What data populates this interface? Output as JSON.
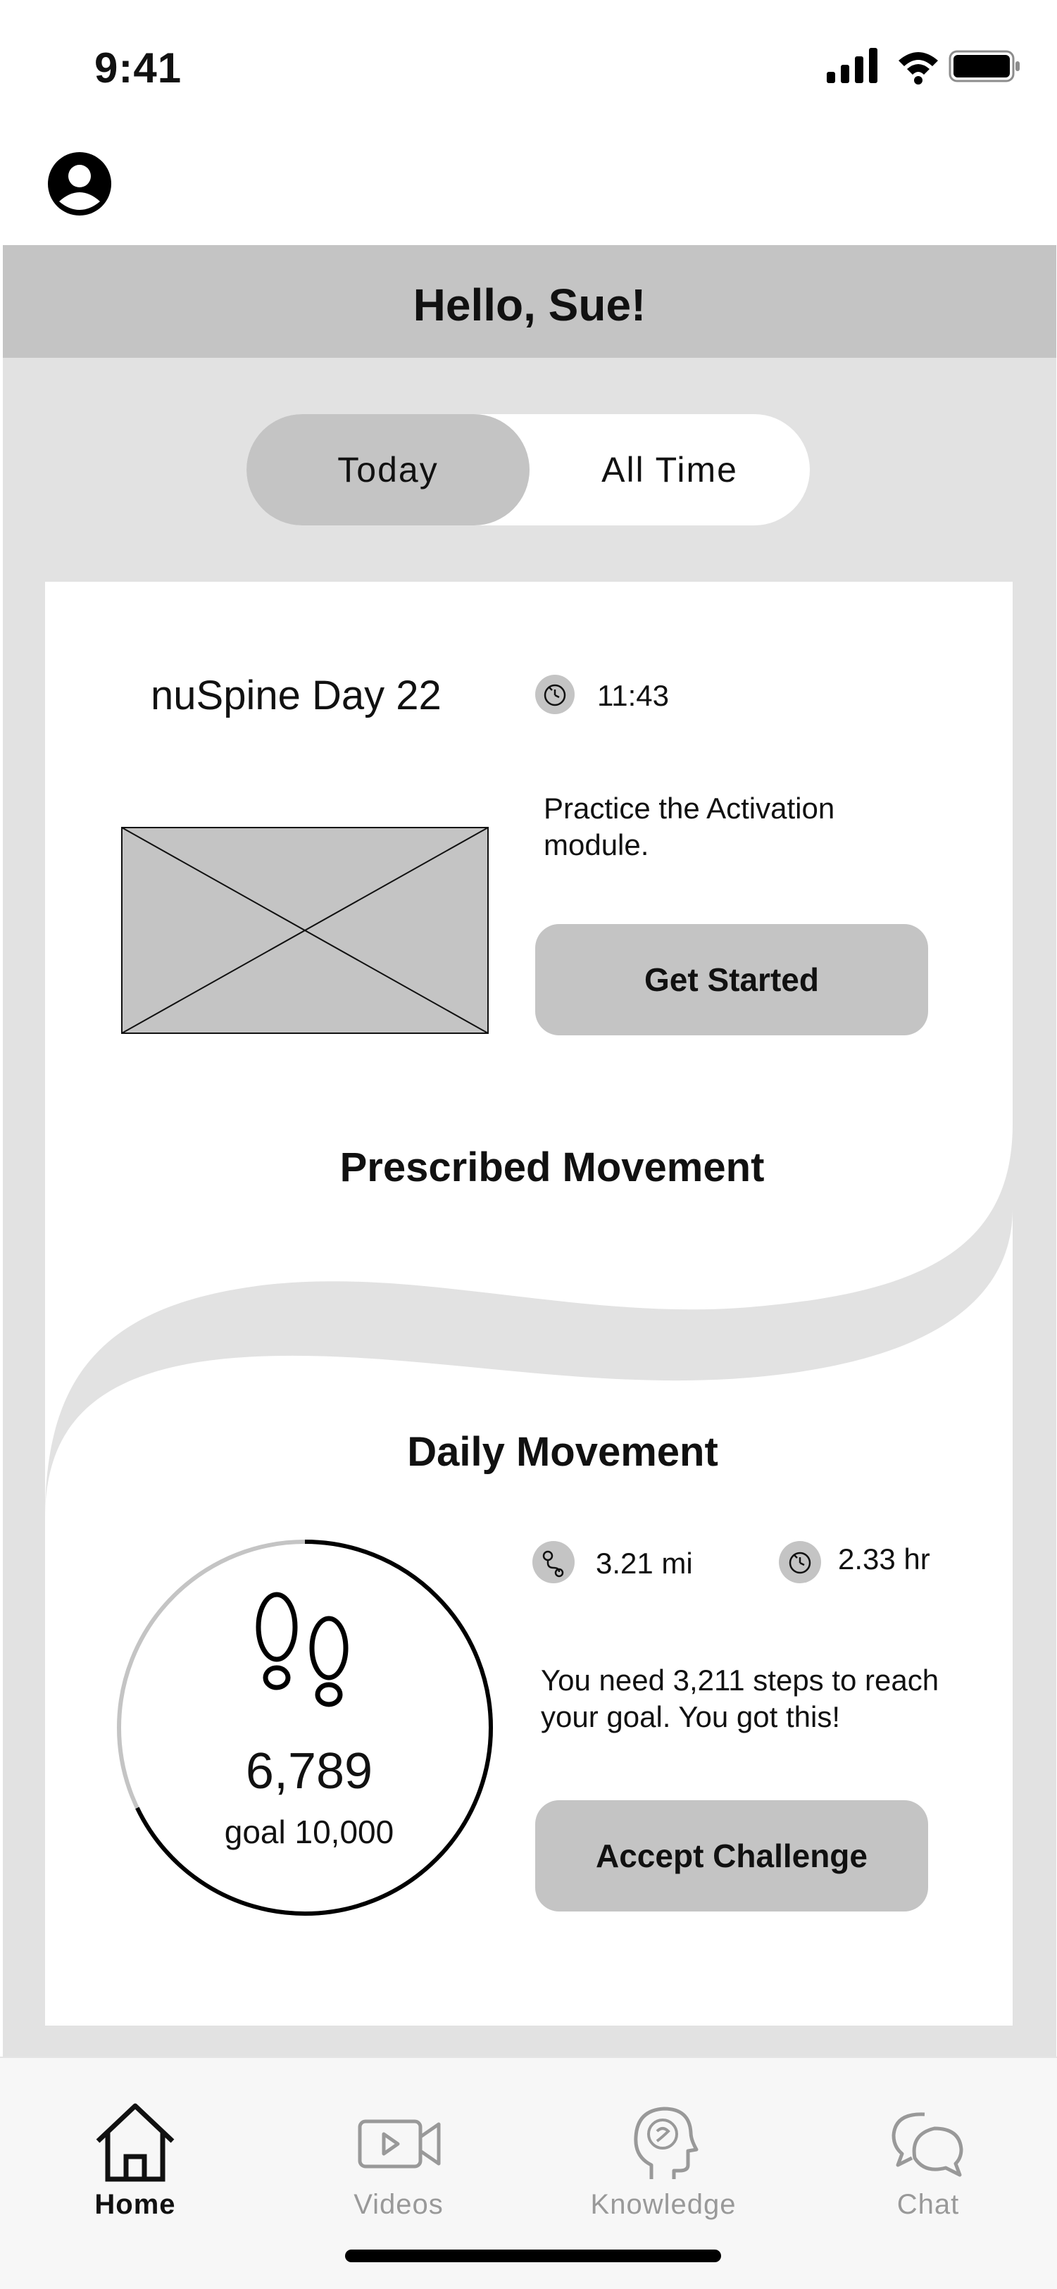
{
  "status_bar": {
    "time": "9:41"
  },
  "greeting": "Hello, Sue!",
  "segment": {
    "today": "Today",
    "all_time": "All Time",
    "selected": "Today"
  },
  "program": {
    "title": "nuSpine Day 22",
    "duration": "11:43",
    "description": "Practice the Activation module.",
    "button": "Get Started"
  },
  "prescribed_title": "Prescribed Movement",
  "daily": {
    "title": "Daily Movement",
    "distance": "3.21 mi",
    "time": "2.33 hr",
    "steps": "6,789",
    "goal": "goal 10,000",
    "progress": 0.6789,
    "message": "You need 3,211 steps to reach your goal. You got this!",
    "button": "Accept Challenge"
  },
  "nav": {
    "home": "Home",
    "videos": "Videos",
    "knowledge": "Knowledge",
    "chat": "Chat",
    "active": "Home"
  }
}
